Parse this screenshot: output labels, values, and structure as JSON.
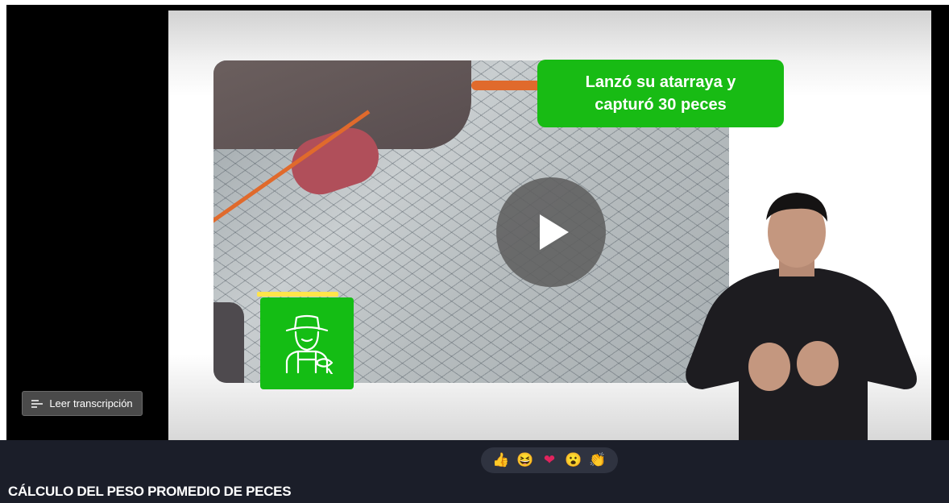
{
  "video": {
    "caption": "Lanzó su atarraya y capturó 30 peces",
    "play_icon": "play-icon",
    "farmer_icon": "fisherman-icon",
    "accent_color": "#18bb14"
  },
  "transcript_button": {
    "label": "Leer transcripción",
    "icon": "transcript-lines-icon"
  },
  "reactions": [
    {
      "name": "thumbs-up",
      "glyph": "👍"
    },
    {
      "name": "laughing",
      "glyph": "😆"
    },
    {
      "name": "heart",
      "glyph": "❤"
    },
    {
      "name": "surprised",
      "glyph": "😮"
    },
    {
      "name": "clapping",
      "glyph": "👏"
    }
  ],
  "page": {
    "title": "CÁLCULO DEL PESO PROMEDIO DE PECES"
  }
}
